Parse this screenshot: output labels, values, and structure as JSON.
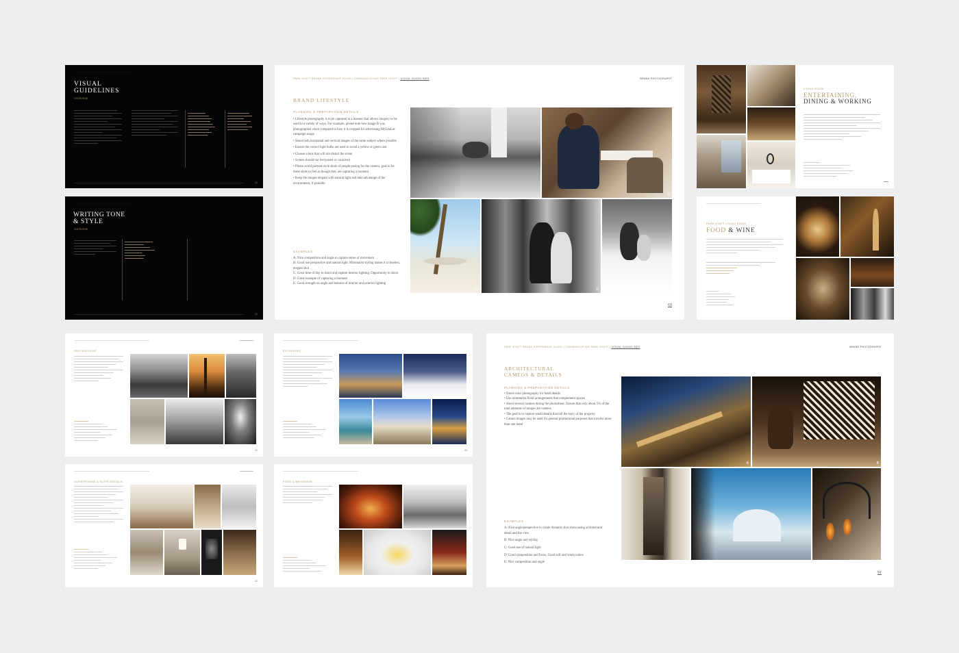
{
  "pages": {
    "visual_guidelines": {
      "title_line1": "VISUAL",
      "title_line2": "GUIDELINES",
      "subtitle": "OVERVIEW",
      "page_num": "22"
    },
    "writing_tone": {
      "title_line1": "WRITING TONE",
      "title_line2": "& STYLE",
      "subtitle": "OVERVIEW",
      "page_num": "22"
    },
    "brand_lifestyle": {
      "header_crumbs": "PARK HYATT BRAND EXPERIENCE GUIDE  |  COMMUNICATING PARK HYATT  |",
      "header_current": "VISUAL GUIDELINES",
      "header_right": "BRAND PHOTOGRAPHY",
      "section_title": "BRAND LIFESTYLE",
      "subhead": "PLANNING & PREPARATION DETAILS",
      "bullets": [
        "Lifestyle photography is to be captured in a manner that allows imagery to be used in a variety of ways. For example, please note how image B was photographed when compared to how it is cropped for advertising/MyLeuLer campaign usage",
        "Shoot both horizontal and vertical images of the same subject where possible",
        "Ensure the correct light bulbs are used to avoid a yellow or green cast",
        "Choose a lens that will not distort the scene",
        "Scenes should not feel posed or contrived",
        "Please avoid portrait-style shots of people posing for the camera, goal is for these shots to feel as though they are capturing a moment",
        "Keep the images elegant with natural light and take advantage of the environment, if possible"
      ],
      "examples_head": "EXAMPLES",
      "examples": [
        "A: Nice composition and angle to capture sense of movement",
        "B: Good use perspective and natural light. Minimalist styling makes it a timeless, elegant shot",
        "C: Good time of day to shoot and capture interior lighting. Opportunity to shoot",
        "D: Great example of capturing a moment",
        "E: Good strength on angle and balance of interior and exterior lighting"
      ],
      "page_num": "69"
    },
    "entertaining": {
      "kicker": "LIVING ROOM",
      "title_line1": "ENTERTAINING,",
      "title_line2": "DINING & WORKING"
    },
    "food_wine": {
      "kicker": "PARK HYATT LIVING ROOM",
      "title_part1": "FOOD",
      "title_amp": " & ",
      "title_part2": "WINE"
    },
    "destinations": {
      "title": "DESTINATIONS",
      "page_num": "22"
    },
    "exteriors": {
      "title": "EXTERIORS",
      "page_num": "22"
    },
    "guestrooms": {
      "title": "GUESTROOMS & SUITE DETAILS",
      "page_num": "22"
    },
    "food_beverage": {
      "title": "FOOD & BEVERAGE",
      "page_num": "22"
    },
    "architectural": {
      "header_crumbs": "PARK HYATT BRAND EXPERIENCE GUIDE  |  COMMUNICATING PARK HYATT  |",
      "header_current": "VISUAL GUIDELINES",
      "header_right": "BRAND PHOTOGRAPHY",
      "title_line1": "ARCHITECTURAL",
      "title_line2": "CAMEOS & DETAILS",
      "subhead": "PLANNING & PREPARATION DETAILS",
      "bullets": [
        "Shoot color photography for hotel details",
        "Use minimalist floral arrangements that complement spaces",
        "Shoot several cameos during the photoshoot. Ensure that only about 5% of the total amounts of images are cameos",
        "The goal is to capture small details that tell the story of the property",
        "Cameo images may be used for general promotional purposes that involve more than one hotel"
      ],
      "examples_head": "EXAMPLES",
      "examples": [
        "A: Nice angle/perspective to create dynamic shot showcasing architectural detail and the view",
        "B: Nice angle and styling",
        "C: Good use of natural light",
        "D: Good composition and focus. Good soft and warm colors",
        "E: Nice composition and angle"
      ],
      "page_num": "91"
    }
  },
  "photo_labels": [
    "A",
    "B",
    "C",
    "D",
    "E"
  ],
  "colors": {
    "background": "#eceef0",
    "accent_gold": "#b49a6a",
    "dark_page": "#050505"
  }
}
